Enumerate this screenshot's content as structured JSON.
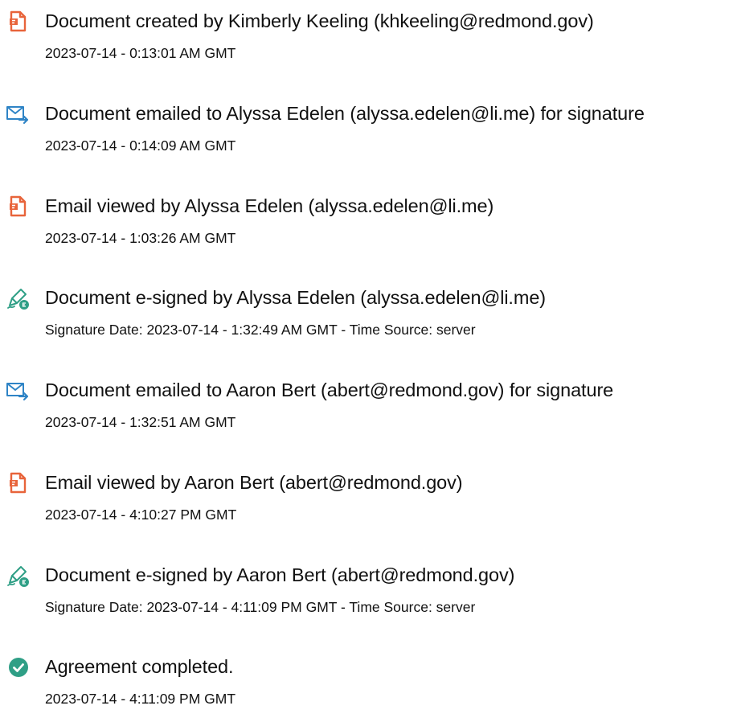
{
  "colors": {
    "doc_icon": "#e8643b",
    "email_icon": "#2f84c6",
    "sign_icon": "#2f9f86",
    "check_icon": "#2f9f86"
  },
  "events": [
    {
      "icon": "document-icon",
      "title": "Document created by Kimberly Keeling (khkeeling@redmond.gov)",
      "meta": "2023-07-14 - 0:13:01 AM GMT"
    },
    {
      "icon": "email-sent-icon",
      "title": "Document emailed to Alyssa Edelen (alyssa.edelen@li.me) for signature",
      "meta": "2023-07-14 - 0:14:09 AM GMT"
    },
    {
      "icon": "document-icon",
      "title": "Email viewed by Alyssa Edelen (alyssa.edelen@li.me)",
      "meta": "2023-07-14 - 1:03:26 AM GMT"
    },
    {
      "icon": "esign-pen-icon",
      "title": "Document e-signed by Alyssa Edelen (alyssa.edelen@li.me)",
      "meta": "Signature Date: 2023-07-14 - 1:32:49 AM GMT - Time Source: server"
    },
    {
      "icon": "email-sent-icon",
      "title": "Document emailed to Aaron Bert (abert@redmond.gov) for signature",
      "meta": "2023-07-14 - 1:32:51 AM GMT"
    },
    {
      "icon": "document-icon",
      "title": "Email viewed by Aaron Bert (abert@redmond.gov)",
      "meta": "2023-07-14 - 4:10:27 PM GMT"
    },
    {
      "icon": "esign-pen-icon",
      "title": "Document e-signed by Aaron Bert (abert@redmond.gov)",
      "meta": "Signature Date: 2023-07-14 - 4:11:09 PM GMT - Time Source: server"
    },
    {
      "icon": "check-circle-icon",
      "title": "Agreement completed.",
      "meta": "2023-07-14 - 4:11:09 PM GMT"
    }
  ]
}
